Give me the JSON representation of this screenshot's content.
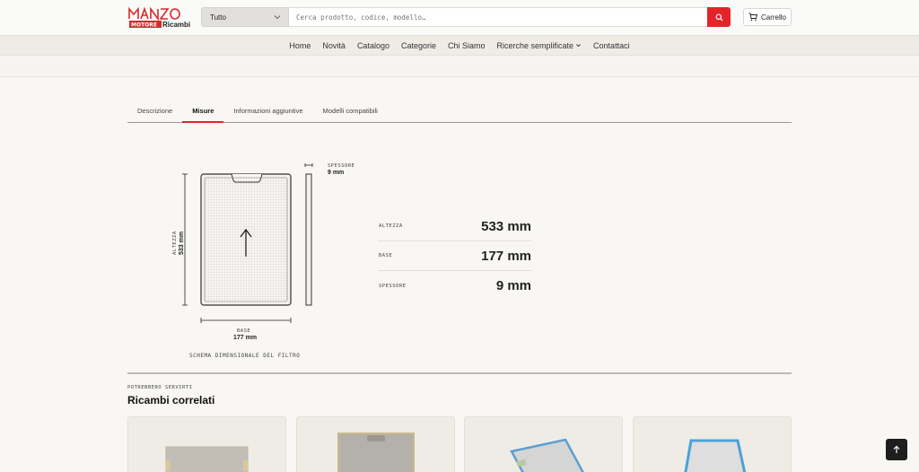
{
  "header": {
    "logo_alt": "Manzo Ricambi",
    "category_select": "Tutto",
    "search_placeholder": "Cerca prodotto, codice, modello…",
    "cart_label": "Carrello"
  },
  "nav": {
    "items": [
      "Home",
      "Novità",
      "Catalogo",
      "Categorie",
      "Chi Siamo",
      "Ricerche semplificate",
      "Contattaci"
    ]
  },
  "tabs": {
    "items": [
      "Descrizione",
      "Misure",
      "Informazioni aggiuntive",
      "Modelli compatibili"
    ],
    "active": "Misure"
  },
  "diagram": {
    "thickness_label": "SPESSORE",
    "thickness_value": "9 mm",
    "height_label": "ALTEZZA",
    "height_value": "533 mm",
    "base_label": "BASE",
    "base_value": "177 mm",
    "caption": "SCHEMA DIMENSIONALE DEL FILTRO"
  },
  "measures": [
    {
      "label": "ALTEZZA",
      "value": "533 mm"
    },
    {
      "label": "BASE",
      "value": "177 mm"
    },
    {
      "label": "SPESSORE",
      "value": "9 mm"
    }
  ],
  "related": {
    "kicker": "POTREBBERO SERVIRTI",
    "title": "Ricambi correlati"
  },
  "colors": {
    "accent": "#e3242b",
    "background": "#f8f7f4",
    "nav_background": "#efece6"
  },
  "icons": [
    "chevron-down-icon",
    "search-icon",
    "cart-icon",
    "arrow-up-icon"
  ]
}
